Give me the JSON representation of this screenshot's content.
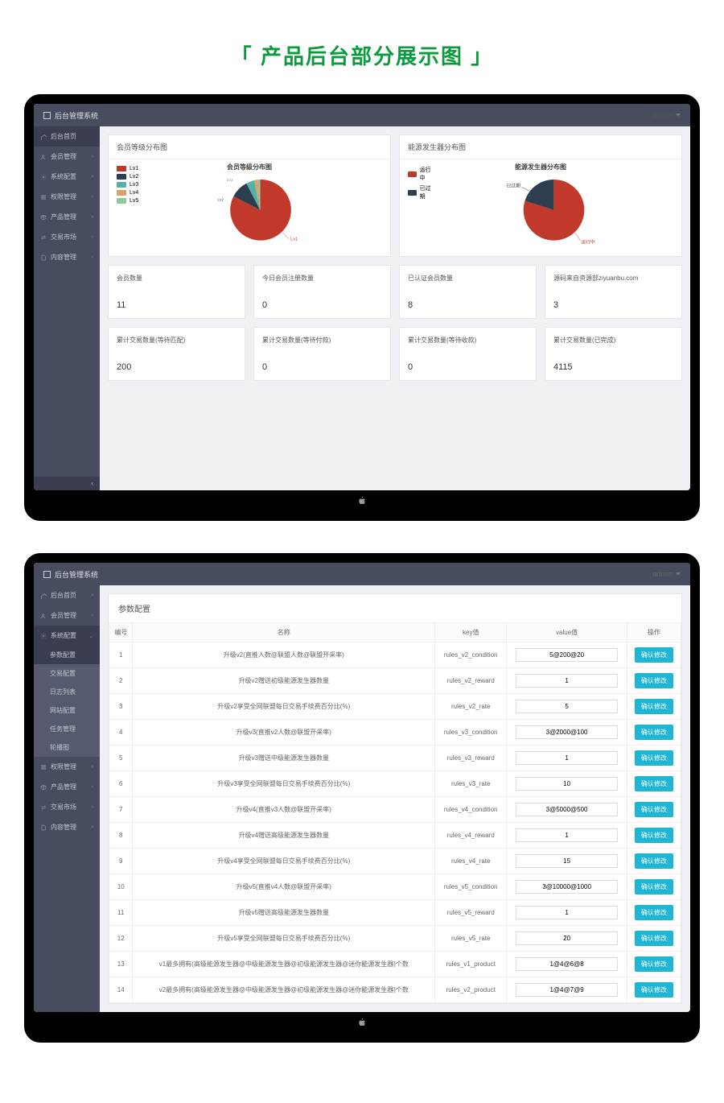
{
  "page_heading": "「 产品后台部分展示图 」",
  "brand": "后台管理系统",
  "user_name": "admin",
  "sidebar1": [
    {
      "icon": "home",
      "label": "后台首页"
    },
    {
      "icon": "users",
      "label": "会员管理"
    },
    {
      "icon": "cog",
      "label": "系统配置"
    },
    {
      "icon": "list",
      "label": "权限管理"
    },
    {
      "icon": "cube",
      "label": "产品管理"
    },
    {
      "icon": "exchange",
      "label": "交易市场"
    },
    {
      "icon": "file",
      "label": "内容管理"
    }
  ],
  "sidebar2": {
    "top": [
      {
        "icon": "home",
        "label": "后台首页"
      },
      {
        "icon": "users",
        "label": "会员管理"
      },
      {
        "icon": "cog",
        "label": "系统配置",
        "expanded": true
      }
    ],
    "sub": [
      "参数配置",
      "交易配置",
      "日志列表",
      "网站配置",
      "任务管理",
      "轮播图"
    ],
    "bottom": [
      {
        "icon": "list",
        "label": "权限管理"
      },
      {
        "icon": "cube",
        "label": "产品管理"
      },
      {
        "icon": "exchange",
        "label": "交易市场"
      },
      {
        "icon": "file",
        "label": "内容管理"
      }
    ]
  },
  "chart1": {
    "card_title": "会员等级分布图",
    "chart_title": "会员等级分布图",
    "legend": [
      {
        "label": "Lv1",
        "color": "#c0392b"
      },
      {
        "label": "Lv2",
        "color": "#2c3e50"
      },
      {
        "label": "Lv3",
        "color": "#52b3a4"
      },
      {
        "label": "Lv4",
        "color": "#d9a26c"
      },
      {
        "label": "Lv5",
        "color": "#8fc7a0"
      }
    ]
  },
  "chart2": {
    "card_title": "能源发生器分布图",
    "chart_title": "能源发生器分布图",
    "legend": [
      {
        "label": "运行中",
        "color": "#c0392b"
      },
      {
        "label": "已过期",
        "color": "#2c3e50"
      }
    ]
  },
  "chart_data": [
    {
      "type": "pie",
      "title": "会员等级分布图",
      "series": [
        {
          "name": "Lv1",
          "value": 7
        },
        {
          "name": "Lv2",
          "value": 2
        },
        {
          "name": "Lv3",
          "value": 1
        },
        {
          "name": "Lv4",
          "value": 0.5
        },
        {
          "name": "Lv5",
          "value": 0.5
        }
      ]
    },
    {
      "type": "pie",
      "title": "能源发生器分布图",
      "series": [
        {
          "name": "运行中",
          "value": 8
        },
        {
          "name": "已过期",
          "value": 3
        }
      ]
    }
  ],
  "stats": [
    {
      "label": "会员数量",
      "value": "11"
    },
    {
      "label": "今日会员注册数量",
      "value": "0"
    },
    {
      "label": "已认证会员数量",
      "value": "8"
    },
    {
      "label": "源码来自资源部ziyuanbu.com",
      "value": "3"
    },
    {
      "label": "累计交易数量(等待匹配)",
      "value": "200"
    },
    {
      "label": "累计交易数量(等待付款)",
      "value": "0"
    },
    {
      "label": "累计交易数量(等待收款)",
      "value": "0"
    },
    {
      "label": "累计交易数量(已完成)",
      "value": "4115"
    }
  ],
  "panel2_title": "参数配置",
  "table": {
    "headers": [
      "编号",
      "名称",
      "key值",
      "value值",
      "操作"
    ],
    "action_label": "确认修改",
    "rows": [
      {
        "id": "1",
        "name": "升级v2(直推人数@联盟人数@联盟开采率)",
        "key": "rules_v2_condition",
        "value": "5@200@20"
      },
      {
        "id": "2",
        "name": "升级v2赠送初级能源发生器数量",
        "key": "rules_v2_reward",
        "value": "1"
      },
      {
        "id": "3",
        "name": "升级v2享受全网联盟每日交易手续费百分比(%)",
        "key": "rules_v2_rate",
        "value": "5"
      },
      {
        "id": "4",
        "name": "升级v3(直推v2人数@联盟开采率)",
        "key": "rules_v3_condition",
        "value": "3@2000@100"
      },
      {
        "id": "5",
        "name": "升级v3赠送中级能源发生器数量",
        "key": "rules_v3_reward",
        "value": "1"
      },
      {
        "id": "6",
        "name": "升级v3享受全网联盟每日交易手续费百分比(%)",
        "key": "rules_v3_rate",
        "value": "10"
      },
      {
        "id": "7",
        "name": "升级v4(直推v3人数@联盟开采率)",
        "key": "rules_v4_condition",
        "value": "3@5000@500"
      },
      {
        "id": "8",
        "name": "升级v4赠送高级能源发生器数量",
        "key": "rules_v4_reward",
        "value": "1"
      },
      {
        "id": "9",
        "name": "升级v4享受全网联盟每日交易手续费百分比(%)",
        "key": "rules_v4_rate",
        "value": "15"
      },
      {
        "id": "10",
        "name": "升级v5(直推v4人数@联盟开采率)",
        "key": "rules_v5_condition",
        "value": "3@10000@1000"
      },
      {
        "id": "11",
        "name": "升级v5赠送高级能源发生器数量",
        "key": "rules_v5_reward",
        "value": "1"
      },
      {
        "id": "12",
        "name": "升级v5享受全网联盟每日交易手续费百分比(%)",
        "key": "rules_v5_rate",
        "value": "20"
      },
      {
        "id": "13",
        "name": "v1最多拥有(高级能源发生器@中级能源发生器@初级能源发生器@迷你能源发生器)个数",
        "key": "rules_v1_product",
        "value": "1@4@6@8"
      },
      {
        "id": "14",
        "name": "v2最多拥有(高级能源发生器@中级能源发生器@初级能源发生器@迷你能源发生器)个数",
        "key": "rules_v2_product",
        "value": "1@4@7@9"
      }
    ]
  }
}
